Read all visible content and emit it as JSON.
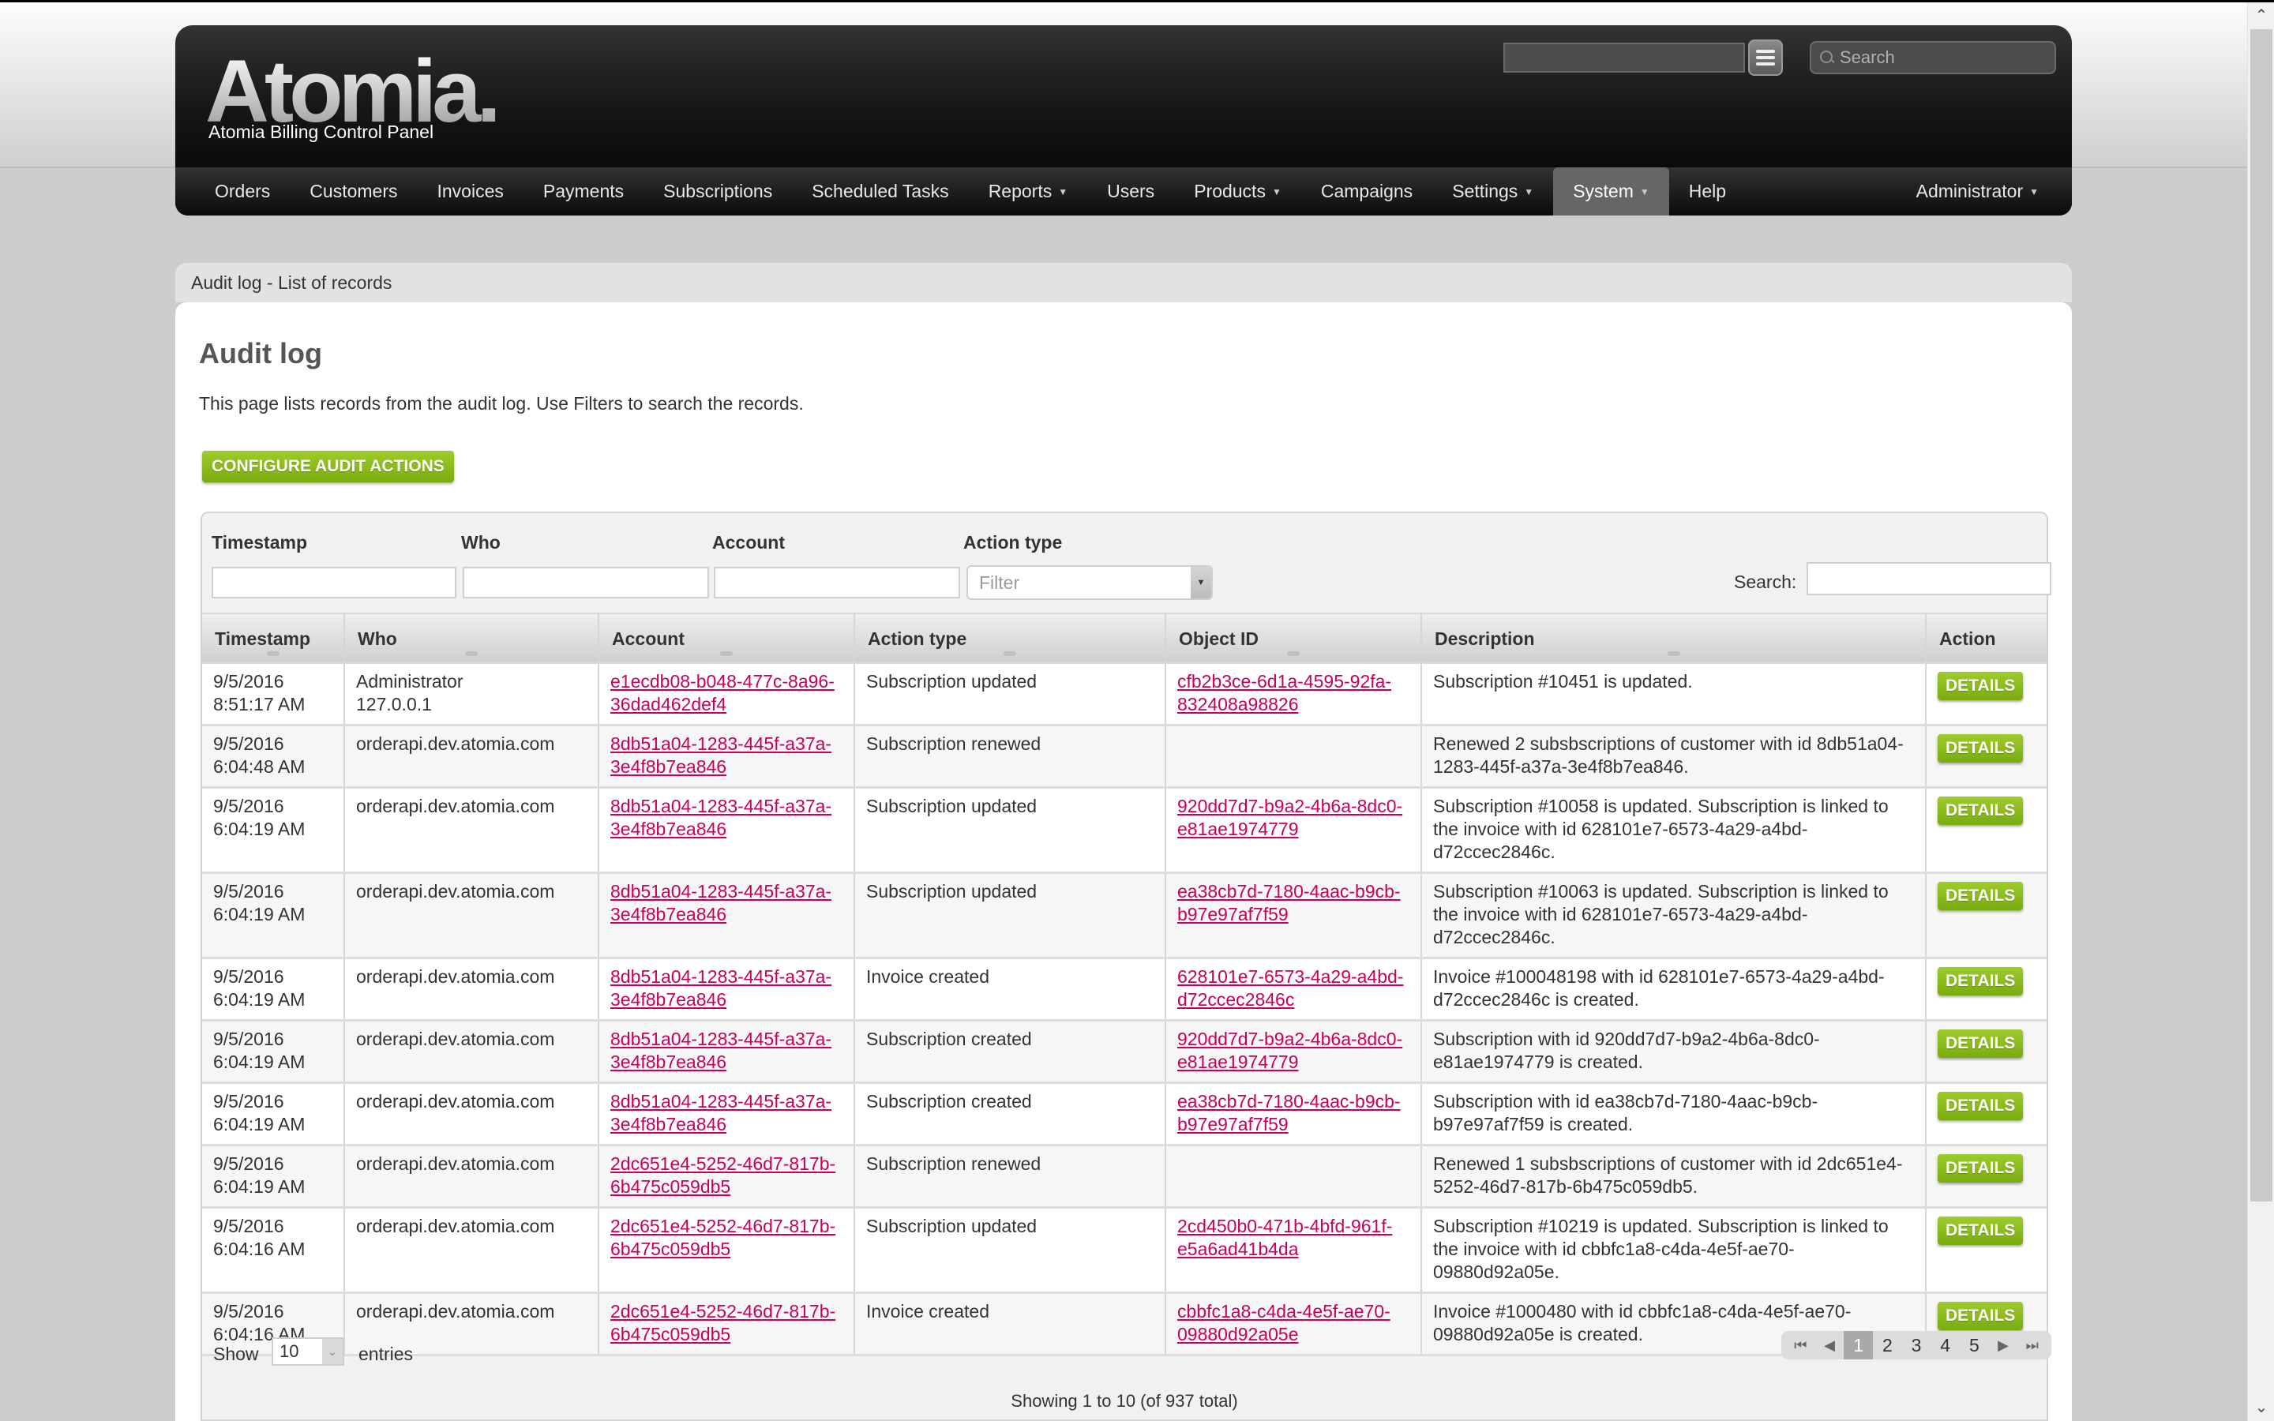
{
  "header": {
    "logo": "Atomia.",
    "subtitle": "Atomia Billing Control Panel",
    "search_placeholder": "Search"
  },
  "nav": {
    "items": [
      {
        "label": "Orders"
      },
      {
        "label": "Customers"
      },
      {
        "label": "Invoices"
      },
      {
        "label": "Payments"
      },
      {
        "label": "Subscriptions"
      },
      {
        "label": "Scheduled Tasks"
      },
      {
        "label": "Reports",
        "dropdown": true
      },
      {
        "label": "Users"
      },
      {
        "label": "Products",
        "dropdown": true
      },
      {
        "label": "Campaigns"
      },
      {
        "label": "Settings",
        "dropdown": true
      },
      {
        "label": "System",
        "dropdown": true,
        "active": true
      },
      {
        "label": "Help"
      }
    ],
    "user": "Administrator"
  },
  "breadcrumb": "Audit log - List of records",
  "page": {
    "title": "Audit log",
    "intro": "This page lists records from the audit log. Use Filters to search the records.",
    "configure_button": "CONFIGURE AUDIT ACTIONS"
  },
  "filters": {
    "timestamp_label": "Timestamp",
    "who_label": "Who",
    "account_label": "Account",
    "action_type_label": "Action type",
    "action_type_placeholder": "Filter",
    "search_label": "Search:"
  },
  "table": {
    "columns": [
      "Timestamp",
      "Who",
      "Account",
      "Action type",
      "Object ID",
      "Description",
      "Action"
    ],
    "action_label": "DETAILS",
    "rows": [
      {
        "date": "9/5/2016",
        "time": "8:51:17 AM",
        "who": "Administrator",
        "who2": "127.0.0.1",
        "account": "e1ecdb08-b048-477c-8a96-36dad462def4",
        "action": "Subscription updated",
        "object": "cfb2b3ce-6d1a-4595-92fa-832408a98826",
        "desc": "Subscription #10451 is updated."
      },
      {
        "date": "9/5/2016",
        "time": "6:04:48 AM",
        "who": "orderapi.dev.atomia.com",
        "who2": "",
        "account": "8db51a04-1283-445f-a37a-3e4f8b7ea846",
        "action": "Subscription renewed",
        "object": "",
        "desc": "Renewed 2 subsbscriptions of customer with id 8db51a04-1283-445f-a37a-3e4f8b7ea846."
      },
      {
        "date": "9/5/2016",
        "time": "6:04:19 AM",
        "who": "orderapi.dev.atomia.com",
        "who2": "",
        "account": "8db51a04-1283-445f-a37a-3e4f8b7ea846",
        "action": "Subscription updated",
        "object": "920dd7d7-b9a2-4b6a-8dc0-e81ae1974779",
        "desc": "Subscription #10058 is updated. Subscription is linked to the invoice with id 628101e7-6573-4a29-a4bd-d72ccec2846c."
      },
      {
        "date": "9/5/2016",
        "time": "6:04:19 AM",
        "who": "orderapi.dev.atomia.com",
        "who2": "",
        "account": "8db51a04-1283-445f-a37a-3e4f8b7ea846",
        "action": "Subscription updated",
        "object": "ea38cb7d-7180-4aac-b9cb-b97e97af7f59",
        "desc": "Subscription #10063 is updated. Subscription is linked to the invoice with id 628101e7-6573-4a29-a4bd-d72ccec2846c."
      },
      {
        "date": "9/5/2016",
        "time": "6:04:19 AM",
        "who": "orderapi.dev.atomia.com",
        "who2": "",
        "account": "8db51a04-1283-445f-a37a-3e4f8b7ea846",
        "action": "Invoice created",
        "object": "628101e7-6573-4a29-a4bd-d72ccec2846c",
        "desc": "Invoice #100048198 with id 628101e7-6573-4a29-a4bd-d72ccec2846c is created."
      },
      {
        "date": "9/5/2016",
        "time": "6:04:19 AM",
        "who": "orderapi.dev.atomia.com",
        "who2": "",
        "account": "8db51a04-1283-445f-a37a-3e4f8b7ea846",
        "action": "Subscription created",
        "object": "920dd7d7-b9a2-4b6a-8dc0-e81ae1974779",
        "desc": "Subscription with id 920dd7d7-b9a2-4b6a-8dc0-e81ae1974779 is created."
      },
      {
        "date": "9/5/2016",
        "time": "6:04:19 AM",
        "who": "orderapi.dev.atomia.com",
        "who2": "",
        "account": "8db51a04-1283-445f-a37a-3e4f8b7ea846",
        "action": "Subscription created",
        "object": "ea38cb7d-7180-4aac-b9cb-b97e97af7f59",
        "desc": "Subscription with id ea38cb7d-7180-4aac-b9cb-b97e97af7f59 is created."
      },
      {
        "date": "9/5/2016",
        "time": "6:04:19 AM",
        "who": "orderapi.dev.atomia.com",
        "who2": "",
        "account": "2dc651e4-5252-46d7-817b-6b475c059db5",
        "action": "Subscription renewed",
        "object": "",
        "desc": "Renewed 1 subsbscriptions of customer with id 2dc651e4-5252-46d7-817b-6b475c059db5."
      },
      {
        "date": "9/5/2016",
        "time": "6:04:16 AM",
        "who": "orderapi.dev.atomia.com",
        "who2": "",
        "account": "2dc651e4-5252-46d7-817b-6b475c059db5",
        "action": "Subscription updated",
        "object": "2cd450b0-471b-4bfd-961f-e5a6ad41b4da",
        "desc": "Subscription #10219 is updated. Subscription is linked to the invoice with id cbbfc1a8-c4da-4e5f-ae70-09880d92a05e."
      },
      {
        "date": "9/5/2016",
        "time": "6:04:16 AM",
        "who": "orderapi.dev.atomia.com",
        "who2": "",
        "account": "2dc651e4-5252-46d7-817b-6b475c059db5",
        "action": "Invoice created",
        "object": "cbbfc1a8-c4da-4e5f-ae70-09880d92a05e",
        "desc": "Invoice #1000480 with id cbbfc1a8-c4da-4e5f-ae70-09880d92a05e is created."
      }
    ]
  },
  "footer": {
    "show_label": "Show",
    "page_length": "10",
    "entries_label": "entries",
    "pages": [
      "1",
      "2",
      "3",
      "4",
      "5"
    ],
    "current_page": "1",
    "showing_text": "Showing 1 to 10 (of 937 total)"
  },
  "colors": {
    "accent_green": "#8abf1d",
    "link": "#c8005a",
    "header_bg": "#111111"
  }
}
